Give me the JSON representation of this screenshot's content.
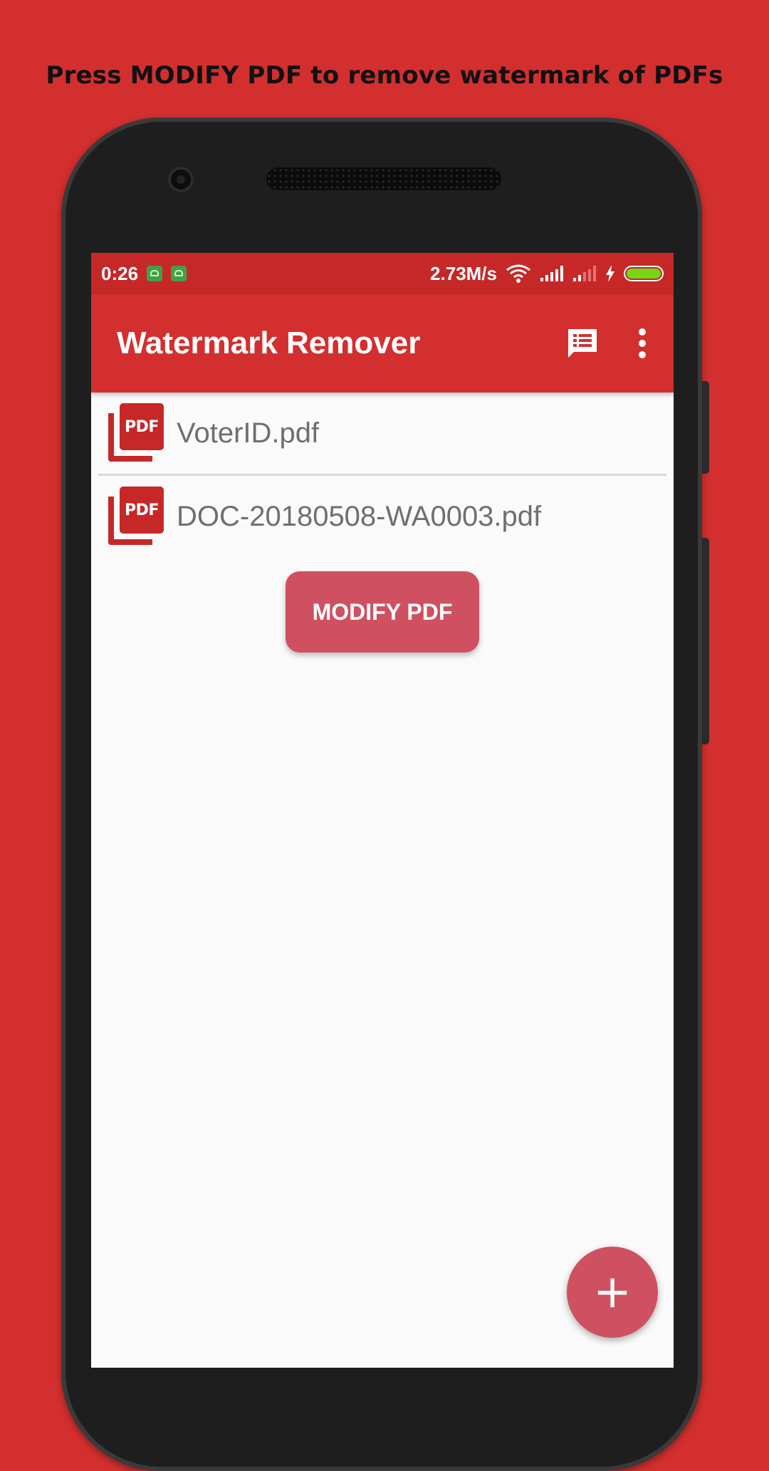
{
  "promo": {
    "headline": "Press MODIFY PDF to remove watermark of PDFs"
  },
  "status_bar": {
    "time": "0:26",
    "network_speed": "2.73M/s",
    "battery_level": 1.0,
    "icons": [
      "app-notification-icon",
      "app-notification-icon",
      "wifi-icon",
      "signal-icon",
      "signal-icon",
      "charging-icon",
      "battery-icon"
    ]
  },
  "app_bar": {
    "title": "Watermark Remover",
    "actions": [
      "feedback-icon",
      "more-vert-icon"
    ]
  },
  "files": [
    {
      "name": "VoterID.pdf",
      "icon": "pdf-icon",
      "icon_text": "PDF"
    },
    {
      "name": "DOC-20180508-WA0003.pdf",
      "icon": "pdf-icon",
      "icon_text": "PDF"
    }
  ],
  "buttons": {
    "modify": "MODIFY PDF",
    "fab": "+"
  },
  "colors": {
    "background": "#d32f2f",
    "status_bar": "#c62828",
    "app_bar": "#d32f2f",
    "button": "#cf5161",
    "file_text": "#6f6f6f"
  }
}
